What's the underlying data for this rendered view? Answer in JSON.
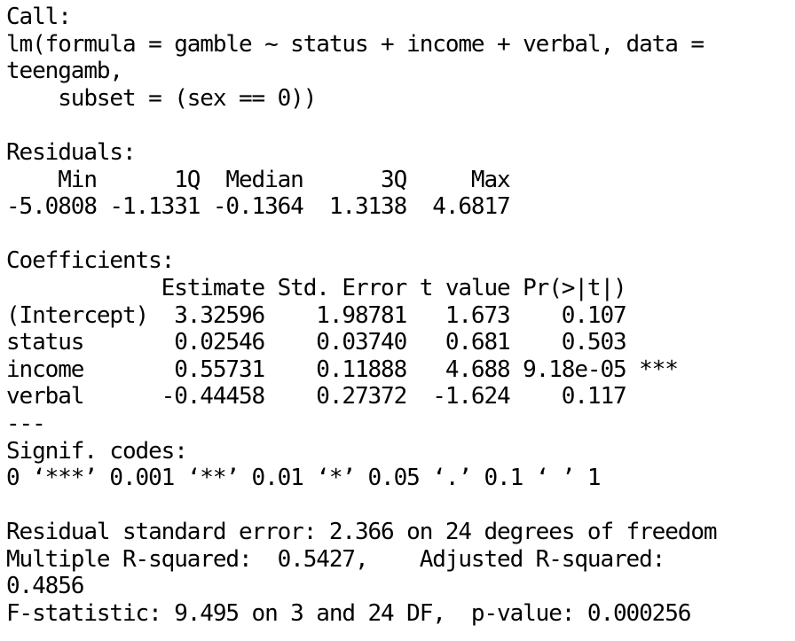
{
  "output": {
    "lines": [
      "Call:",
      "lm(formula = gamble ~ status + income + verbal, data =",
      "teengamb,",
      "    subset = (sex == 0))",
      "",
      "Residuals:",
      "    Min      1Q  Median      3Q     Max",
      "-5.0808 -1.1331 -0.1364  1.3138  4.6817",
      "",
      "Coefficients:",
      "            Estimate Std. Error t value Pr(>|t|)",
      "(Intercept)  3.32596    1.98781   1.673    0.107",
      "status       0.02546    0.03740   0.681    0.503",
      "income       0.55731    0.11888   4.688 9.18e-05 ***",
      "verbal      -0.44458    0.27372  -1.624    0.117",
      "---",
      "Signif. codes:",
      "0 ‘***’ 0.001 ‘**’ 0.01 ‘*’ 0.05 ‘.’ 0.1 ‘ ’ 1",
      "",
      "Residual standard error: 2.366 on 24 degrees of freedom",
      "Multiple R-squared:  0.5427,    Adjusted R-squared:",
      "0.4856",
      "F-statistic: 9.495 on 3 and 24 DF,  p-value: 0.000256"
    ]
  }
}
